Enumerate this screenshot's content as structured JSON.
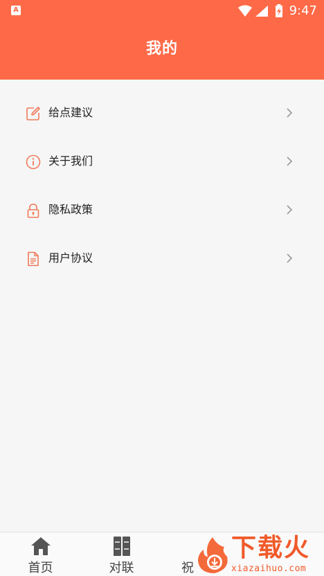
{
  "status_bar": {
    "app_badge": "A",
    "time": "9:47"
  },
  "header": {
    "title": "我的"
  },
  "menu": {
    "items": [
      {
        "label": "给点建议",
        "icon": "edit-icon"
      },
      {
        "label": "关于我们",
        "icon": "info-icon"
      },
      {
        "label": "隐私政策",
        "icon": "lock-icon"
      },
      {
        "label": "用户协议",
        "icon": "document-icon"
      }
    ]
  },
  "tabbar": {
    "tabs": [
      {
        "label": "首页",
        "icon": "home-icon"
      },
      {
        "label": "对联",
        "icon": "couplet-icon"
      },
      {
        "label": "祝",
        "icon": "tab-icon"
      }
    ]
  },
  "watermark": {
    "brand": "下载火",
    "url": "xiazaihuo.com"
  },
  "colors": {
    "accent": "#fe6a48",
    "background": "#f6f6f6",
    "icon_accent": "#f07a5a"
  }
}
